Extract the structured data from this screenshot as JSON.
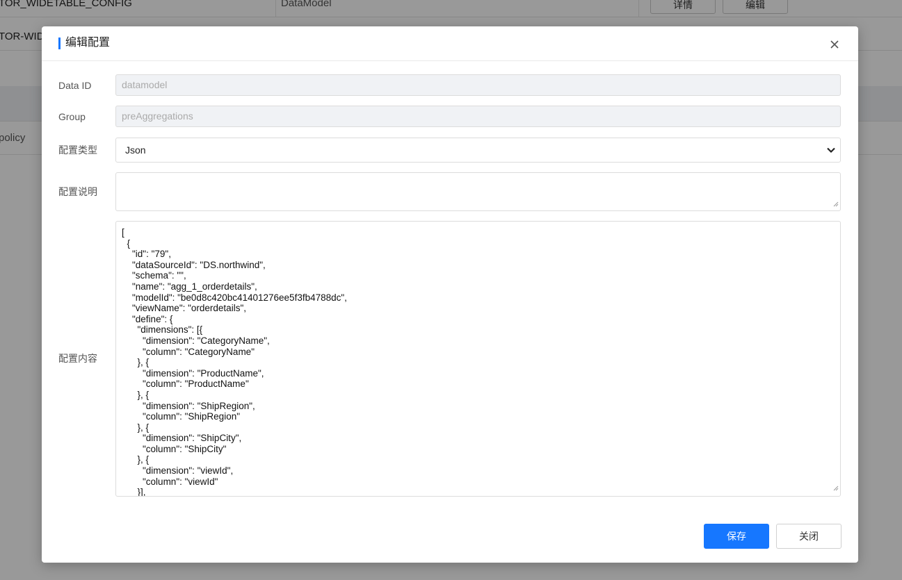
{
  "background": {
    "row1": {
      "name_cell": "TOR_WIDETABLE_CONFIG",
      "type_cell": "DataModel",
      "btn_detail": "详情",
      "btn_edit": "编辑"
    },
    "row2": {
      "name_cell": "TOR-WID"
    },
    "row4": {
      "name_cell": "policy"
    }
  },
  "modal": {
    "title": "编辑配置",
    "accent_color": "#1677ff",
    "fields": {
      "data_id": {
        "label": "Data ID",
        "value": "datamodel"
      },
      "group": {
        "label": "Group",
        "value": "preAggregations"
      },
      "config_type": {
        "label": "配置类型",
        "selected": "Json"
      },
      "config_desc": {
        "label": "配置说明",
        "value": ""
      },
      "config_content": {
        "label": "配置内容",
        "lines": [
          "[",
          "  {",
          "    \"id\": \"79\",",
          "    \"dataSourceId\": \"DS.northwind\",",
          "    \"schema\": \"\",",
          "    \"name\": \"agg_1_orderdetails\",",
          "    \"modelId\": \"be0d8c420bc41401276ee5f3fb4788dc\",",
          "    \"viewName\": \"orderdetails\",",
          "    \"define\": {",
          "      \"dimensions\": [{",
          "        \"dimension\": \"CategoryName\",",
          "        \"column\": \"CategoryName\"",
          "      }, {",
          "        \"dimension\": \"ProductName\",",
          "        \"column\": \"ProductName\"",
          "      }, {",
          "        \"dimension\": \"ShipRegion\",",
          "        \"column\": \"ShipRegion\"",
          "      }, {",
          "        \"dimension\": \"ShipCity\",",
          "        \"column\": \"ShipCity\"",
          "      }, {",
          "        \"dimension\": \"viewId\",",
          "        \"column\": \"viewId\"",
          "      }],"
        ]
      }
    },
    "buttons": {
      "save": "保存",
      "close": "关闭"
    }
  },
  "icons": {
    "close": "close-icon",
    "select": "chevron-down-icon",
    "resize": "resize-grip-icon"
  }
}
